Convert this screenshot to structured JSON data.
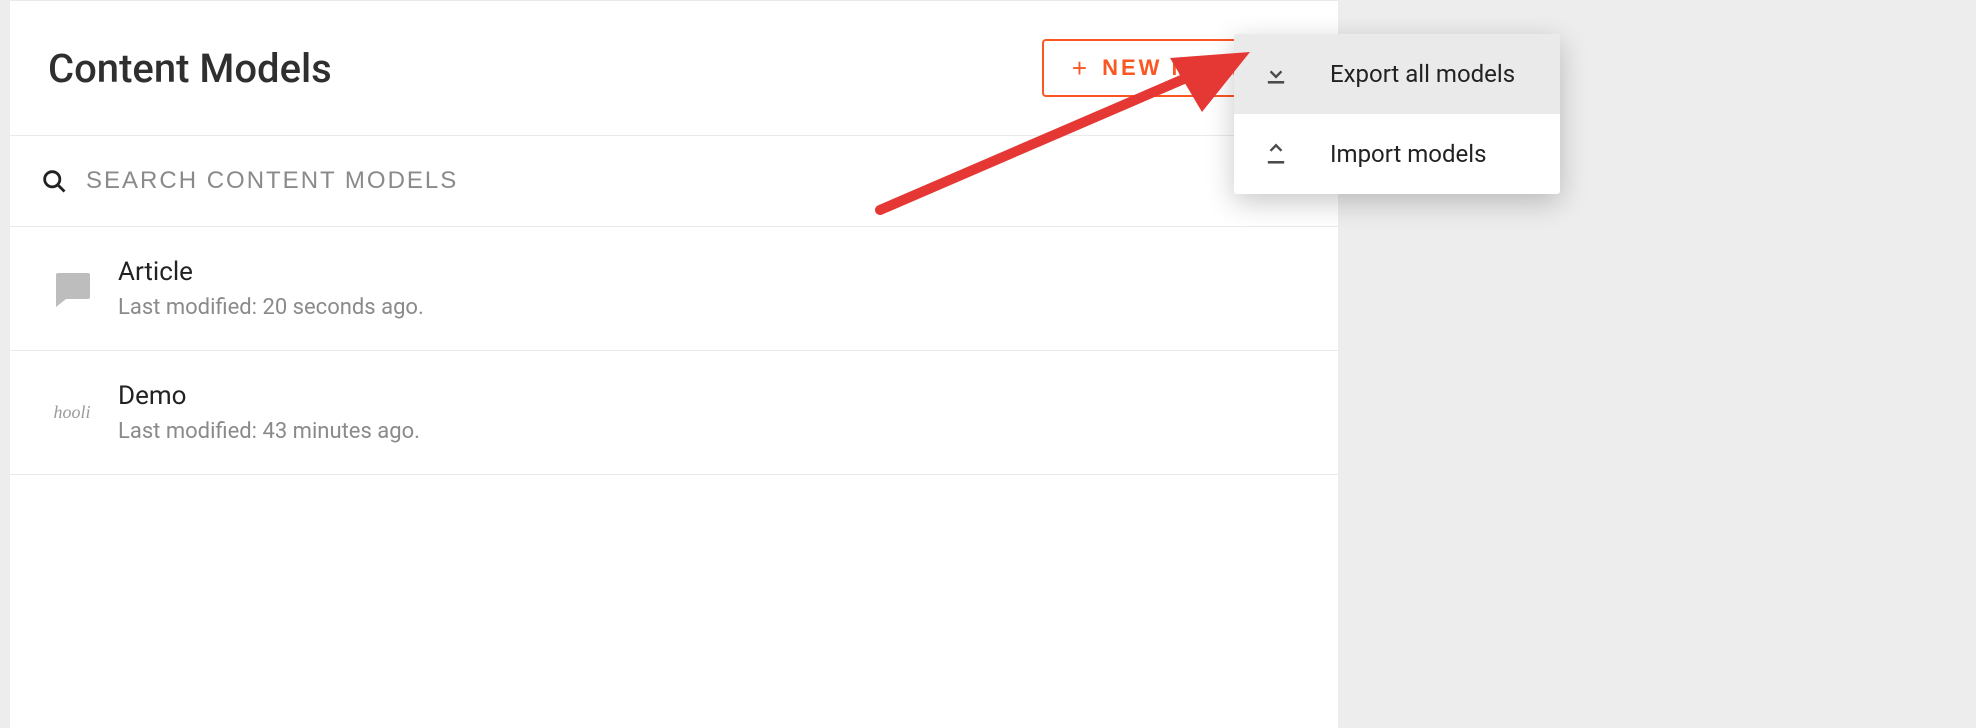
{
  "header": {
    "title": "Content Models",
    "new_model_label": "NEW MODEL"
  },
  "search": {
    "placeholder": "SEARCH CONTENT MODELS"
  },
  "models": [
    {
      "name": "Article",
      "modified": "Last modified: 20 seconds ago.",
      "icon": "chat"
    },
    {
      "name": "Demo",
      "modified": "Last modified: 43 minutes ago.",
      "icon": "hooli"
    }
  ],
  "menu": {
    "export_label": "Export all models",
    "import_label": "Import models"
  }
}
